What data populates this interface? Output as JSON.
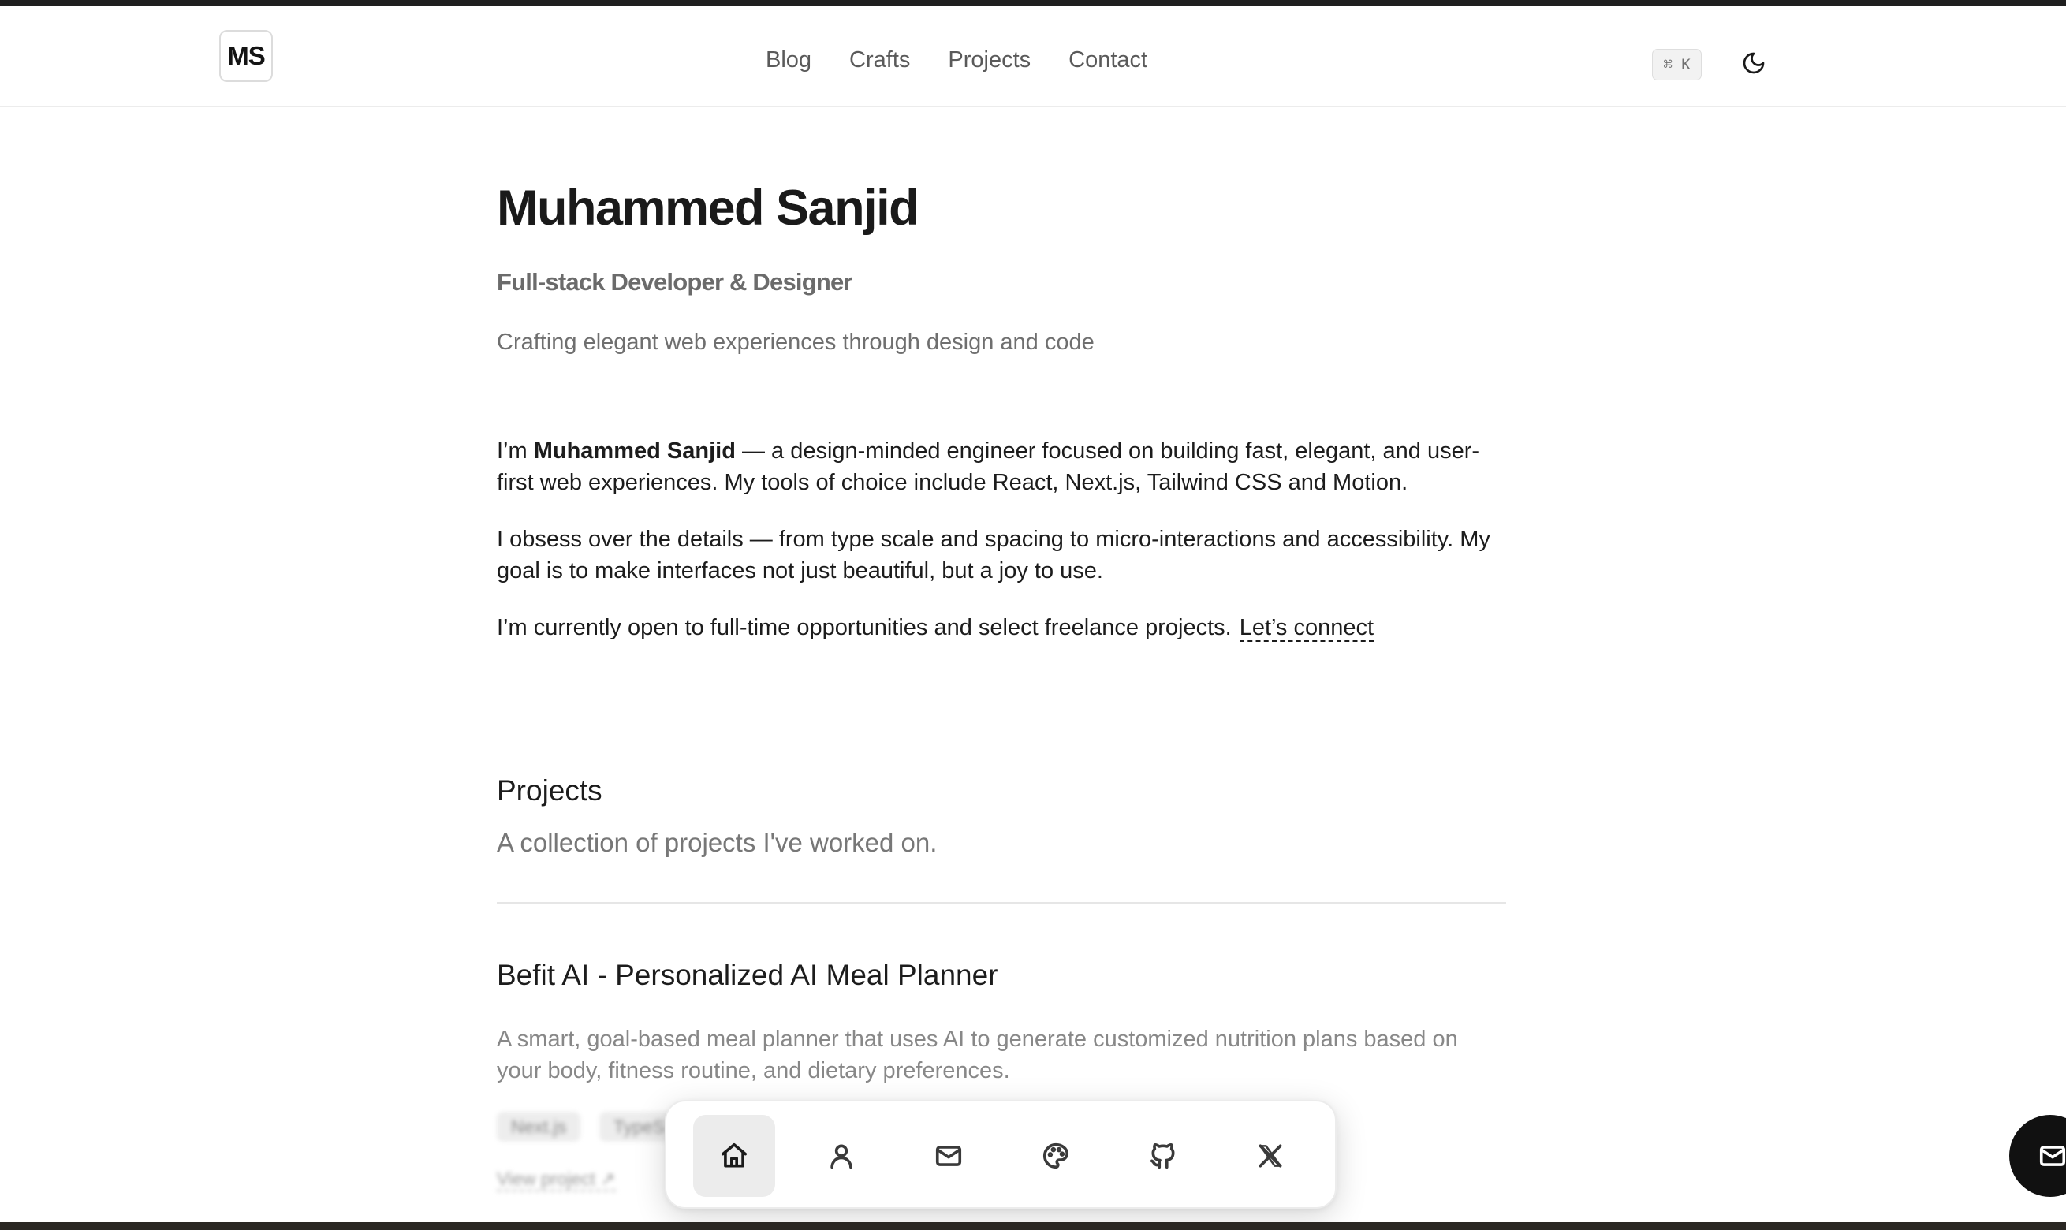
{
  "header": {
    "logo_text": "MS",
    "nav": [
      "Blog",
      "Crafts",
      "Projects",
      "Contact"
    ],
    "shortcut": "⌘ K",
    "theme_toggle_icon": "moon-icon"
  },
  "hero": {
    "name": "Muhammed Sanjid",
    "role": "Full-stack Developer & Designer",
    "tagline": "Crafting elegant web experiences through design and code"
  },
  "about": {
    "p1_prefix": "I’m ",
    "p1_name": "Muhammed Sanjid",
    "p1_rest": " — a design-minded engineer focused on building fast, elegant, and user-first web experiences. My tools of choice include React, Next.js, Tailwind CSS and Motion.",
    "p2": "I obsess over the details — from type scale and spacing to micro-interactions and accessibility. My goal is to make interfaces not just beautiful, but a joy to use.",
    "p3": "I’m currently open to full-time opportunities and select freelance projects.",
    "connect_label": "Let’s connect"
  },
  "projects": {
    "title": "Projects",
    "subtitle": "A collection of projects I've worked on.",
    "items": [
      {
        "title": "Befit AI - Personalized AI Meal Planner",
        "description": "A smart, goal-based meal planner that uses AI to generate customized nutrition plans based on your body, fitness routine, and dietary preferences.",
        "tags": [
          "Next.js",
          "TypeS"
        ],
        "link_label": "View project ↗"
      }
    ]
  },
  "dock": {
    "items": [
      {
        "icon": "home-icon",
        "active": true
      },
      {
        "icon": "user-icon",
        "active": false
      },
      {
        "icon": "mail-icon",
        "active": false
      },
      {
        "icon": "palette-icon",
        "active": false
      },
      {
        "icon": "github-icon",
        "active": false
      },
      {
        "icon": "x-icon",
        "active": false
      }
    ]
  },
  "fab": {
    "icon": "mail-icon"
  },
  "colors": {
    "text": "#1c1c1c",
    "muted": "#6f6f6f",
    "border": "#ececec",
    "dock_active": "#ececec",
    "fab_bg": "#111111"
  }
}
